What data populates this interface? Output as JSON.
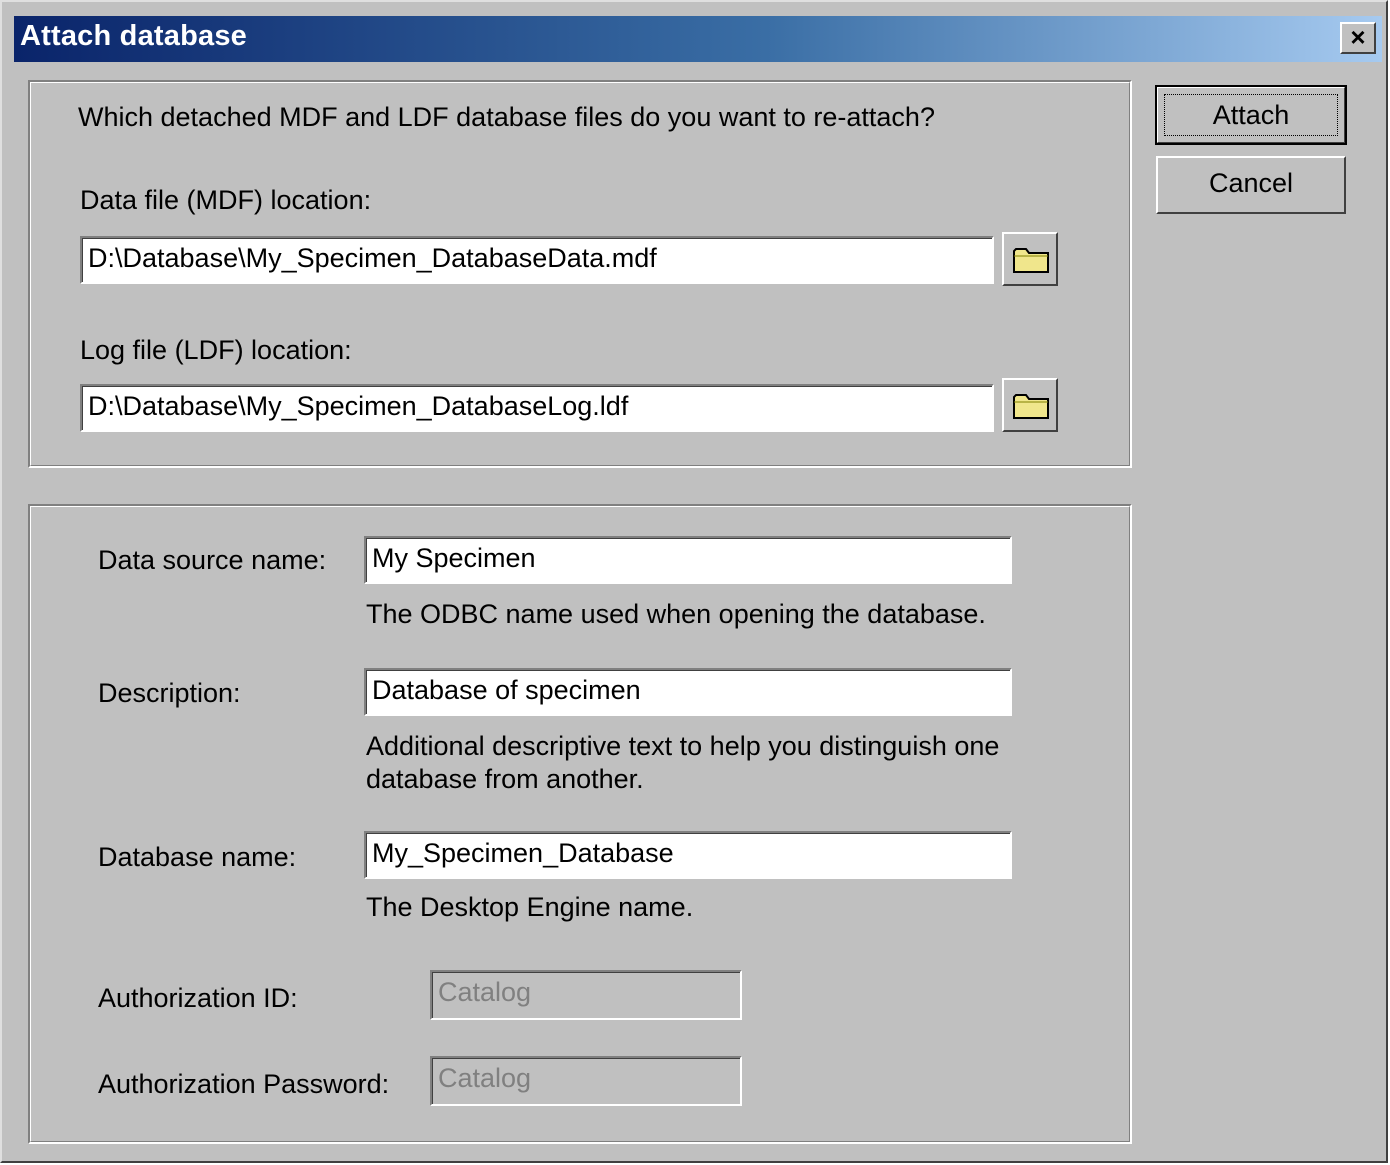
{
  "window": {
    "title": "Attach database",
    "close_glyph": "×"
  },
  "files": {
    "question": "Which detached MDF and LDF database files do you want to re-attach?",
    "mdf_label": "Data file (MDF) location:",
    "mdf_value": "D:\\Database\\My_Specimen_DatabaseData.mdf",
    "ldf_label": "Log file (LDF) location:",
    "ldf_value": "D:\\Database\\My_Specimen_DatabaseLog.ldf",
    "browse_icon": "folder-icon"
  },
  "details": {
    "dsn_label": "Data source name:",
    "dsn_value": "My Specimen",
    "dsn_hint": "The ODBC name used when opening the database.",
    "description_label": "Description:",
    "description_value": "Database of specimen",
    "description_hint_line1": "Additional descriptive text to help you distinguish one",
    "description_hint_line2": "database from another.",
    "dbname_label": "Database name:",
    "dbname_value": "My_Specimen_Database",
    "dbname_hint": "The Desktop Engine name.",
    "auth_id_label": "Authorization ID:",
    "auth_id_value": "Catalog",
    "auth_password_label": "Authorization Password:",
    "auth_password_value": "Catalog"
  },
  "buttons": {
    "attach": "Attach",
    "cancel": "Cancel"
  },
  "colors": {
    "face": "#c0c0c0",
    "title_start": "#0a246a",
    "title_end": "#a6caf0",
    "folder": "#f0e68c"
  }
}
